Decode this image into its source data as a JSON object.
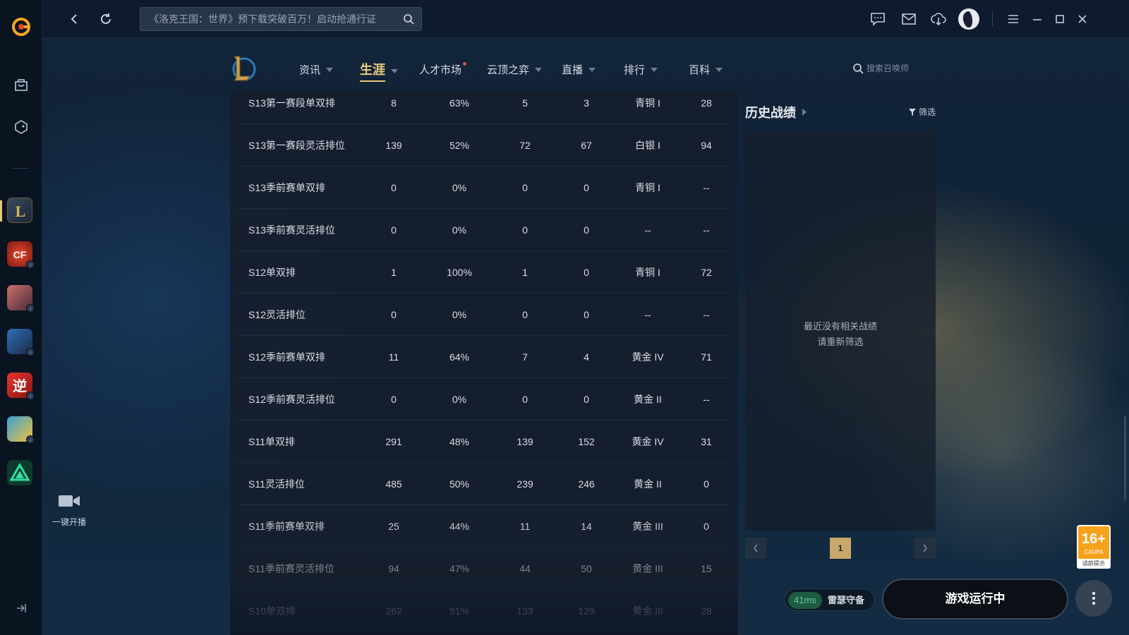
{
  "top": {
    "search_placeholder": "《洛克王国：世界》预下载突破百万！启动抢通行证"
  },
  "nav": {
    "items": [
      {
        "label": "资讯"
      },
      {
        "label": "生涯"
      },
      {
        "label": "人才市场"
      },
      {
        "label": "云顶之弈"
      },
      {
        "label": "直播"
      },
      {
        "label": "排行"
      },
      {
        "label": "百科"
      }
    ],
    "search_placeholder": "搜索召唤师"
  },
  "table": {
    "rows": [
      [
        "S13第一赛段单双排",
        "8",
        "63%",
        "5",
        "3",
        "青铜 I",
        "28"
      ],
      [
        "S13第一赛段灵活排位",
        "139",
        "52%",
        "72",
        "67",
        "白银 I",
        "94"
      ],
      [
        "S13季前赛单双排",
        "0",
        "0%",
        "0",
        "0",
        "青铜 I",
        "--"
      ],
      [
        "S13季前赛灵活排位",
        "0",
        "0%",
        "0",
        "0",
        "--",
        "--"
      ],
      [
        "S12单双排",
        "1",
        "100%",
        "1",
        "0",
        "青铜 I",
        "72"
      ],
      [
        "S12灵活排位",
        "0",
        "0%",
        "0",
        "0",
        "--",
        "--"
      ],
      [
        "S12季前赛单双排",
        "11",
        "64%",
        "7",
        "4",
        "黄金 IV",
        "71"
      ],
      [
        "S12季前赛灵活排位",
        "0",
        "0%",
        "0",
        "0",
        "黄金 II",
        "--"
      ],
      [
        "S11单双排",
        "291",
        "48%",
        "139",
        "152",
        "黄金 IV",
        "31"
      ],
      [
        "S11灵活排位",
        "485",
        "50%",
        "239",
        "246",
        "黄金 II",
        "0"
      ],
      [
        "S11季前赛单双排",
        "25",
        "44%",
        "11",
        "14",
        "黄金 III",
        "0"
      ],
      [
        "S11季前赛灵活排位",
        "94",
        "47%",
        "44",
        "50",
        "黄金 III",
        "15"
      ],
      [
        "S10单双排",
        "262",
        "51%",
        "133",
        "129",
        "黄金 III",
        "28"
      ]
    ]
  },
  "history": {
    "title": "历史战绩",
    "filter_label": "筛选",
    "empty_line1": "最近没有相关战绩",
    "empty_line2": "请重新筛选",
    "page": "1"
  },
  "status": {
    "ping": "41ms",
    "server": "雷瑟守备",
    "launch_label": "游戏运行中"
  },
  "age_badge": {
    "age": "16+",
    "org": "CADPA",
    "tip": "适龄提示"
  },
  "sidebar": {
    "live_label": "一键开播"
  },
  "colors": {
    "accent_gold": "#e8c97a",
    "ping_green": "#5fd39a"
  }
}
